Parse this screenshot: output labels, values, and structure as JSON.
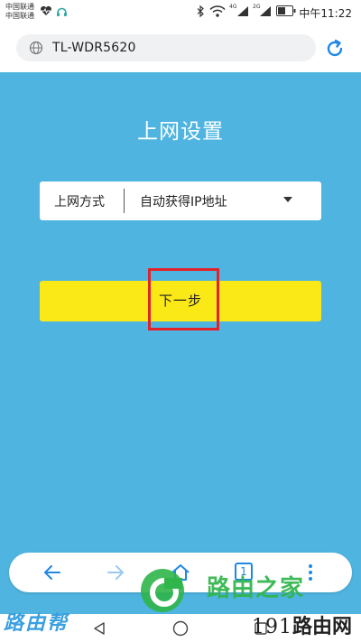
{
  "status_bar": {
    "carrier_line1": "中国联通",
    "carrier_line2": "中国联通",
    "signal_1_label": "4G",
    "signal_2_label": "2G",
    "time": "中午11:22"
  },
  "browser": {
    "url": "TL-WDR5620"
  },
  "page": {
    "title": "上网设置",
    "connection_label": "上网方式",
    "connection_value": "自动获得IP地址",
    "next_button": "下一步"
  },
  "toolbar": {
    "tab_count": "1"
  },
  "watermarks": {
    "left": "路由帮",
    "middle": "路由之家",
    "right_number": "191",
    "right_text": "路由网"
  },
  "colors": {
    "page_background": "#4fb5e0",
    "button_yellow": "#fbe817",
    "highlight_red": "#e2222a",
    "accent_blue": "#1e88e5"
  }
}
